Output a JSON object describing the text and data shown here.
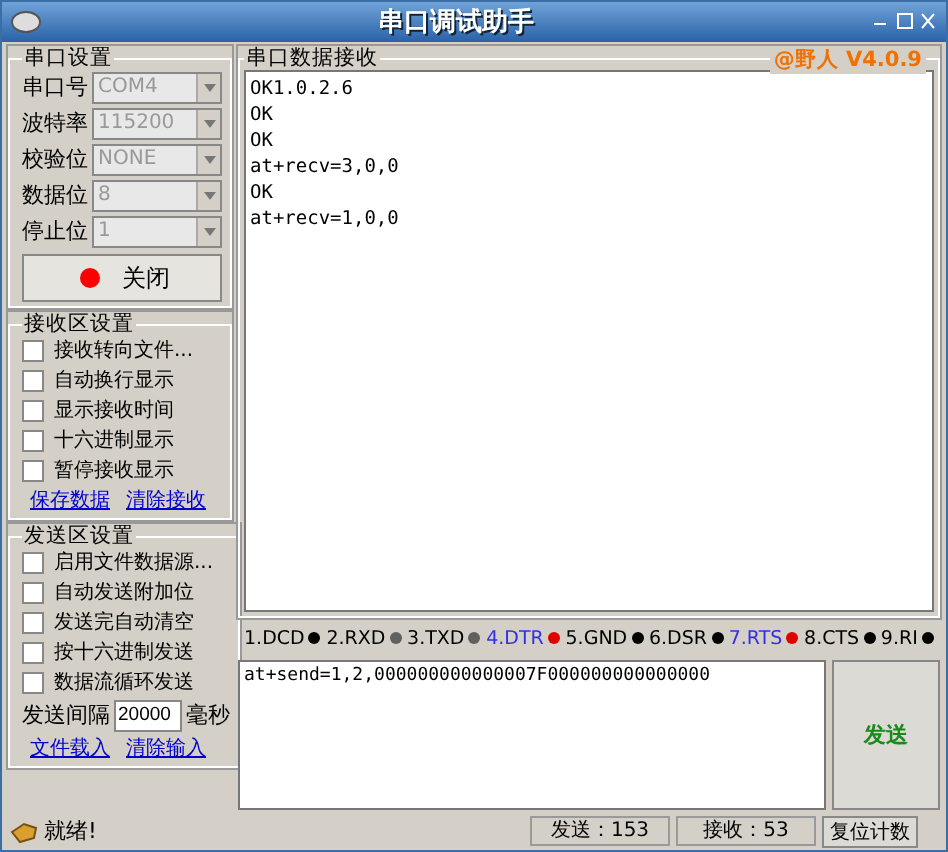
{
  "window": {
    "title": "串口调试助手"
  },
  "port_settings": {
    "title": "串口设置",
    "fields": [
      {
        "label": "串口号",
        "value": "COM4"
      },
      {
        "label": "波特率",
        "value": "115200"
      },
      {
        "label": "校验位",
        "value": "NONE"
      },
      {
        "label": "数据位",
        "value": "8"
      },
      {
        "label": "停止位",
        "value": "1"
      }
    ],
    "open_button": {
      "label": "关闭",
      "on": true
    }
  },
  "receive_settings": {
    "title": "接收区设置",
    "options": [
      {
        "label": "接收转向文件...",
        "checked": false
      },
      {
        "label": "自动换行显示",
        "checked": false
      },
      {
        "label": "显示接收时间",
        "checked": false
      },
      {
        "label": "十六进制显示",
        "checked": false
      },
      {
        "label": "暂停接收显示",
        "checked": false
      }
    ],
    "links": [
      "保存数据",
      "清除接收"
    ]
  },
  "send_settings": {
    "title": "发送区设置",
    "options": [
      {
        "label": "启用文件数据源...",
        "checked": false
      },
      {
        "label": "自动发送附加位",
        "checked": false
      },
      {
        "label": "发送完自动清空",
        "checked": false
      },
      {
        "label": "按十六进制发送",
        "checked": false
      },
      {
        "label": "数据流循环发送",
        "checked": false
      }
    ],
    "interval_label": "发送间隔",
    "interval_value": "20000",
    "interval_unit": "毫秒",
    "links": [
      "文件载入",
      "清除输入"
    ]
  },
  "receive": {
    "title": "串口数据接收",
    "version": "@野人 V4.0.9",
    "lines": [
      "OK1.0.2.6",
      "OK",
      "OK",
      "at+recv=3,0,0",
      "OK",
      "at+recv=1,0,0"
    ]
  },
  "signals": [
    {
      "label": "1.DCD",
      "on": false,
      "color": "#000000"
    },
    {
      "label": "2.RXD",
      "on": false,
      "color": "#606060"
    },
    {
      "label": "3.TXD",
      "on": false,
      "color": "#606060"
    },
    {
      "label": "4.DTR",
      "on": true,
      "color": "#e00000"
    },
    {
      "label": "5.GND",
      "on": false,
      "color": "#000000"
    },
    {
      "label": "6.DSR",
      "on": false,
      "color": "#000000"
    },
    {
      "label": "7.RTS",
      "on": true,
      "color": "#e00000"
    },
    {
      "label": "8.CTS",
      "on": false,
      "color": "#000000"
    },
    {
      "label": "9.RI",
      "on": false,
      "color": "#000000"
    }
  ],
  "send": {
    "value": "at+send=1,2,000000000000007F000000000000000",
    "button": "发送"
  },
  "status_bar": {
    "message": "就绪!",
    "sent": "发送：153",
    "received": "接收：53",
    "reset_button": "复位计数"
  }
}
